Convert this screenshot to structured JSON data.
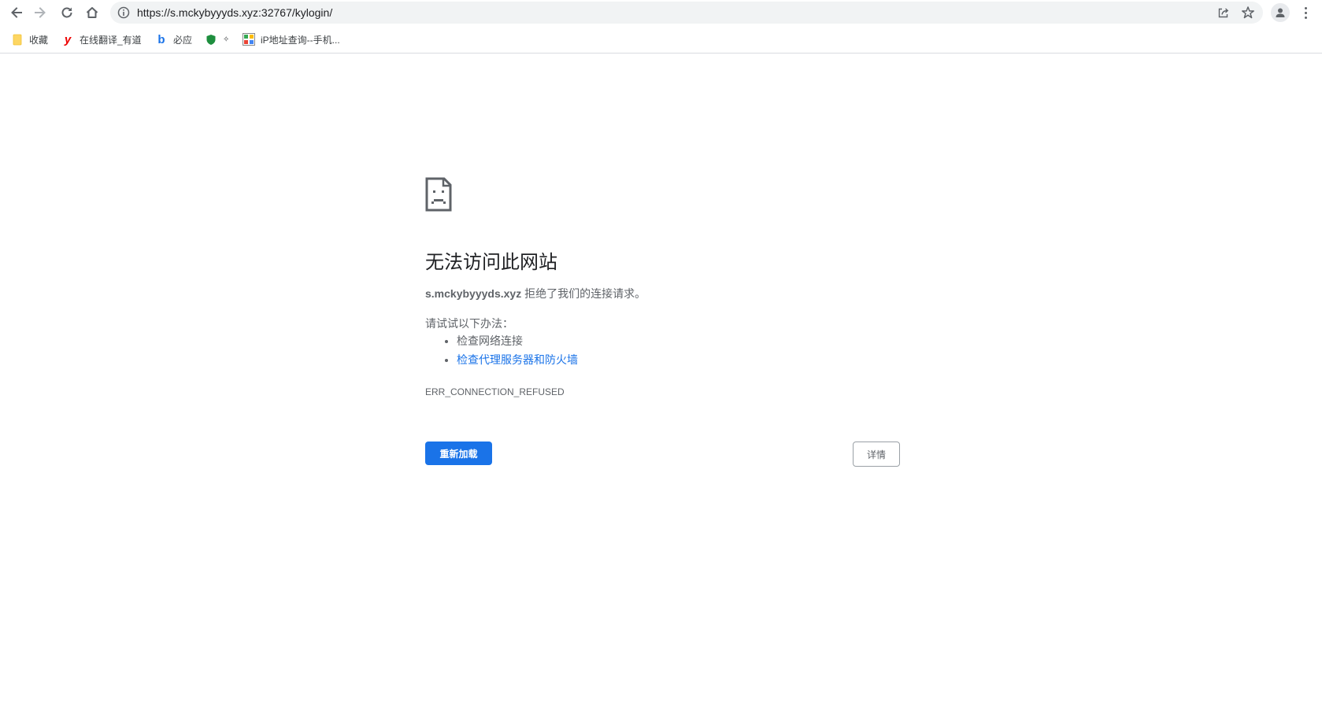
{
  "browser": {
    "url": "https://s.mckybyyyds.xyz:32767/kylogin/",
    "icons": {
      "back": "arrow-left-icon",
      "forward": "arrow-right-icon",
      "reload": "reload-icon",
      "home": "home-icon",
      "site_info": "info-icon",
      "share": "share-icon",
      "bookmark_star": "star-icon",
      "profile": "profile-icon",
      "menu": "kebab-menu-icon"
    }
  },
  "bookmarks": [
    {
      "label": "收藏",
      "icon": "folder-icon"
    },
    {
      "label": "在线翻译_有道",
      "icon": "youdao-icon"
    },
    {
      "label": "必应",
      "icon": "bing-icon"
    },
    {
      "label": "✧",
      "icon": "shield-icon"
    },
    {
      "label": "iP地址查询--手机...",
      "icon": "ip-lookup-icon"
    }
  ],
  "error_page": {
    "icon": "sad-document-icon",
    "headline": "无法访问此网站",
    "host": "s.mckybyyyds.xyz",
    "message": " 拒绝了我们的连接请求。",
    "try_label": "请试试以下办法：",
    "suggestions": [
      {
        "text": "检查网络连接",
        "is_link": false
      },
      {
        "text": "检查代理服务器和防火墙",
        "is_link": true
      }
    ],
    "error_code": "ERR_CONNECTION_REFUSED",
    "reload_label": "重新加载",
    "details_label": "详情"
  },
  "colors": {
    "accent": "#1a73e8",
    "text_primary": "#202124",
    "text_secondary": "#5f6368",
    "omnibox_bg": "#f1f3f4"
  }
}
